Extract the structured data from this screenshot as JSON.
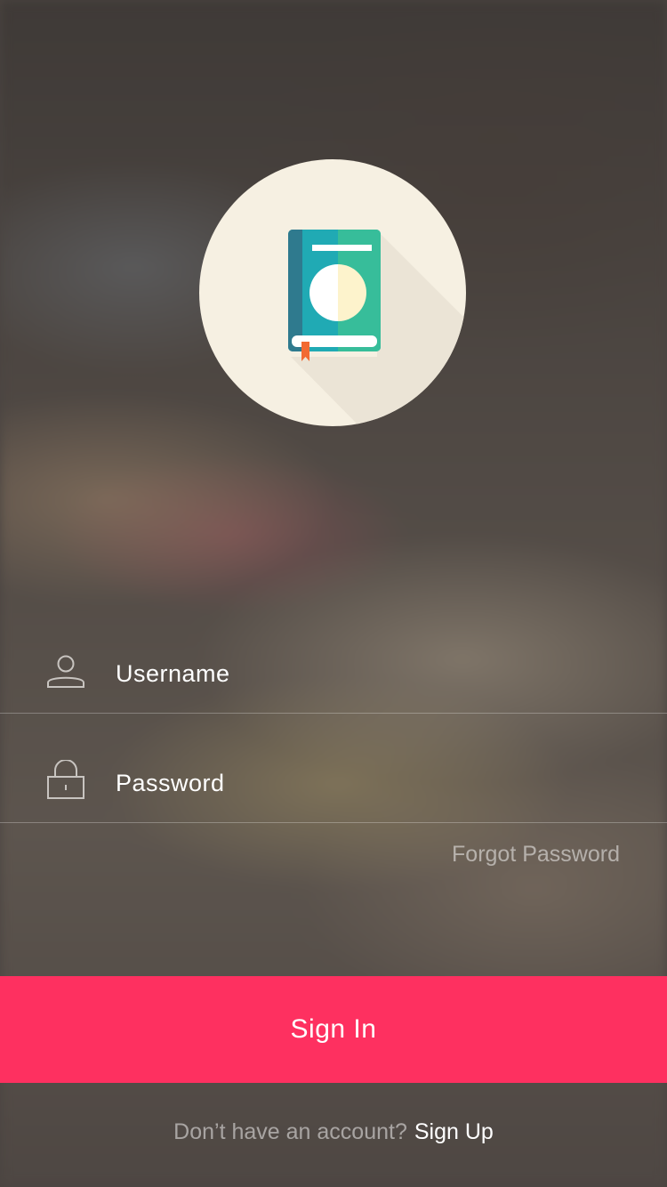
{
  "logo": {
    "icon": "book-icon",
    "colors": {
      "circle": "#f6f0e2",
      "spine": "#2f7a8e",
      "cover_left": "#20aab4",
      "cover_right": "#37bd9a",
      "bookmark": "#f26a32"
    }
  },
  "form": {
    "username": {
      "placeholder": "Username",
      "icon": "user-icon"
    },
    "password": {
      "placeholder": "Password",
      "icon": "lock-icon"
    },
    "forgot_password": "Forgot Password"
  },
  "sign_in": {
    "label": "Sign In",
    "color": "#fe3060"
  },
  "footer": {
    "question": "Don’t have an account?",
    "sign_up": "Sign Up"
  }
}
